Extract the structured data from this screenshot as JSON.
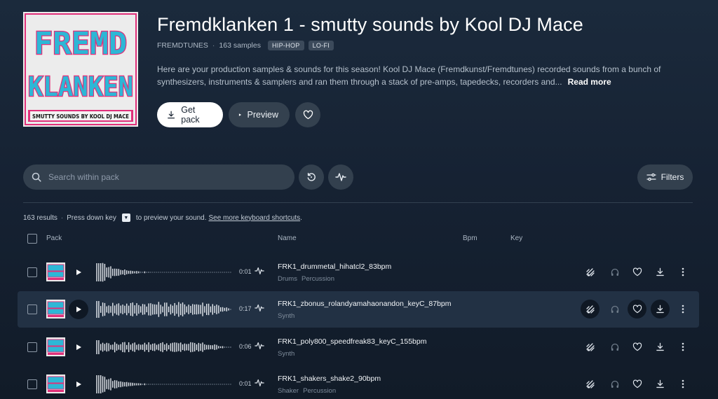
{
  "pack": {
    "title": "Fremdklanken 1 - smutty sounds by Kool DJ Mace",
    "label": "FREMDTUNES",
    "sample_count": "163 samples",
    "tags": [
      "HIP-HOP",
      "LO-FI"
    ],
    "description": "Here are your production samples & sounds for this season! Kool DJ Mace (Fremdkunst/Fremdtunes) recorded sounds from a bunch of synthesizers, instruments & samplers and ran them through a stack of pre-amps, tapedecks, recorders and...",
    "read_more": "Read more",
    "cover_text": [
      "FREMD",
      "KLANKEN",
      "SMUTTY SOUNDS BY KOOL DJ MACE"
    ]
  },
  "actions": {
    "get_pack": "Get pack",
    "preview": "Preview"
  },
  "search": {
    "placeholder": "Search within pack",
    "filters": "Filters"
  },
  "results_bar": {
    "count": "163 results",
    "hint_before": "Press down key",
    "hint_after": "to preview your sound.",
    "shortcuts_link": "See more keyboard shortcuts",
    "period": "."
  },
  "columns": {
    "pack": "Pack",
    "name": "Name",
    "bpm": "Bpm",
    "key": "Key"
  },
  "rows": [
    {
      "name": "FRK1_drummetal_hihatcl2_83bpm",
      "duration": "0:01",
      "tags": [
        "Drums",
        "Percussion"
      ],
      "waveform": "decay",
      "active": false
    },
    {
      "name": "FRK1_zbonus_rolandyamahaonandon_keyC_87bpm",
      "duration": "0:17",
      "tags": [
        "Synth"
      ],
      "waveform": "dense",
      "active": true
    },
    {
      "name": "FRK1_poly800_speedfreak83_keyC_155bpm",
      "duration": "0:06",
      "tags": [
        "Synth"
      ],
      "waveform": "medium",
      "active": false
    },
    {
      "name": "FRK1_shakers_shake2_90bpm",
      "duration": "0:01",
      "tags": [
        "Shaker",
        "Percussion"
      ],
      "waveform": "decay",
      "active": false
    }
  ],
  "colors": {
    "background": "#162233",
    "cover_pink": "#e0307a",
    "cover_cyan": "#2db7d6",
    "waveform": "#ffffff"
  }
}
